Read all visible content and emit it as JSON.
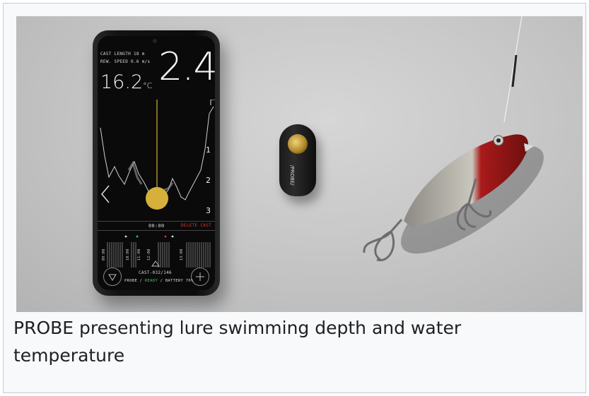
{
  "caption": "PROBE presenting lure swimming depth and water temperature",
  "phone": {
    "cast_length_label": "CAST LENGTH",
    "cast_length_value": "18 m",
    "rew_speed_label": "REW. SPEED",
    "rew_speed_value": "0.6 m/s",
    "temperature": "16.2",
    "temperature_unit": "°C",
    "depth": "2.4",
    "depth_ticks": [
      "1",
      "2",
      "3"
    ],
    "timer": "00:00",
    "delete_cast": "DELETE CAST",
    "timeline_labels": [
      "09:00",
      "10:00",
      "11:00",
      "12:00",
      "13:00"
    ],
    "cast_id": "CAST-032/146",
    "status_probe": "PROBE",
    "status_ready": "READY",
    "status_battery_label": "BATTERY",
    "status_battery_value": "76%",
    "icons": {
      "back": "chevron-left-icon",
      "filter": "triangle-down-icon",
      "add": "plus-icon",
      "up": "triangle-up-icon"
    }
  },
  "probe_device": {
    "label": "/PROBE/"
  },
  "colors": {
    "accent_gold": "#d6b03a",
    "delete_red": "#e0352b",
    "ready_green": "#3cc46a"
  }
}
